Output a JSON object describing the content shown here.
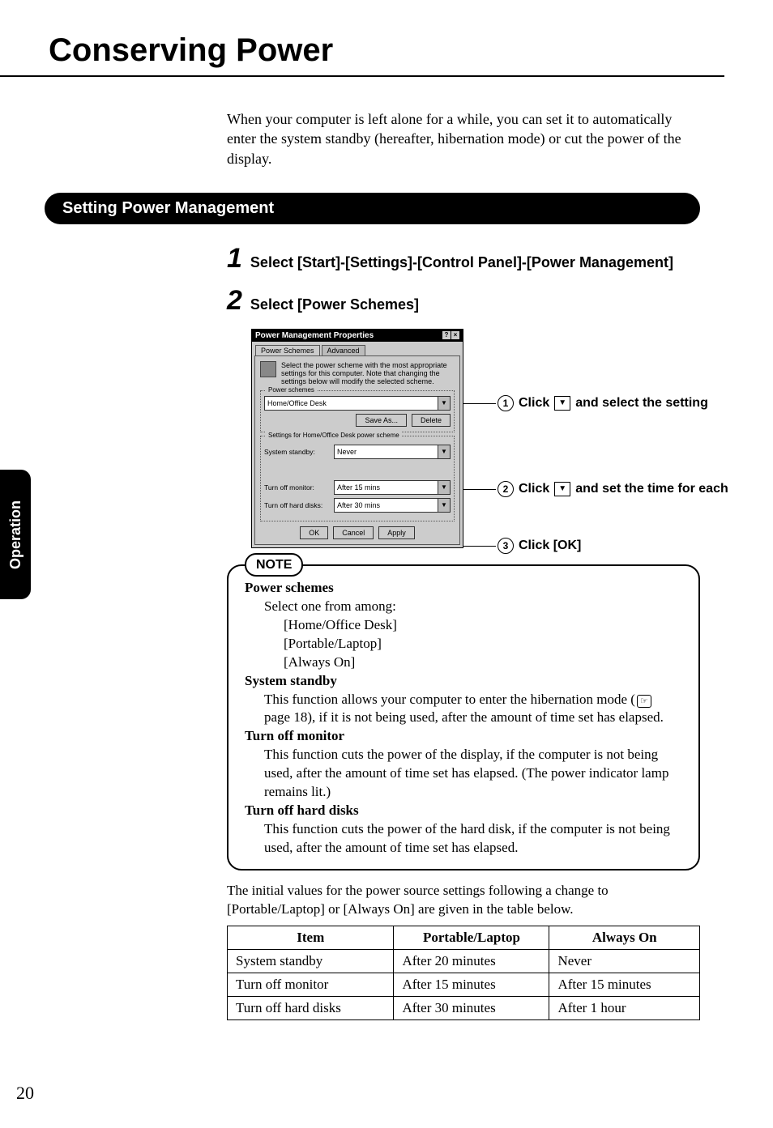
{
  "title": "Conserving Power",
  "intro": "When your computer is left alone for a while, you can set it to automatically enter the system standby (hereafter, hibernation mode) or cut the power of the display.",
  "side_tab": "Operation",
  "section_heading": "Setting Power Management",
  "steps": {
    "s1_num": "1",
    "s1_text": "Select [Start]-[Settings]-[Control Panel]-[Power Management]",
    "s2_num": "2",
    "s2_text": "Select [Power Schemes]"
  },
  "dialog": {
    "title": "Power Management Properties",
    "tab_active": "Power Schemes",
    "tab_inactive": "Advanced",
    "desc": "Select the power scheme with the most appropriate settings for this computer. Note that changing the settings below will modify the selected scheme.",
    "legend1": "Power schemes",
    "scheme_value": "Home/Office Desk",
    "btn_save": "Save As...",
    "btn_delete": "Delete",
    "legend2": "Settings for Home/Office Desk power scheme",
    "row_standby_label": "System standby:",
    "row_standby_value": "Never",
    "row_monitor_label": "Turn off monitor:",
    "row_monitor_value": "After 15 mins",
    "row_hd_label": "Turn off hard disks:",
    "row_hd_value": "After 30 mins",
    "btn_ok": "OK",
    "btn_cancel": "Cancel",
    "btn_apply": "Apply"
  },
  "callouts": {
    "c1_num": "1",
    "c1_pre": "Click",
    "c1_post": "and select the setting",
    "c2_num": "2",
    "c2_pre": "Click",
    "c2_post": "and set the time for each",
    "c3_num": "3",
    "c3_text": "Click [OK]"
  },
  "note": {
    "label": "NOTE",
    "h1": "Power schemes",
    "h1_sub": "Select one from among:",
    "h1_opt1": "[Home/Office Desk]",
    "h1_opt2": "[Portable/Laptop]",
    "h1_opt3": "[Always On]",
    "h2": "System standby",
    "h2_body_a": "This function allows your computer to enter the hibernation mode (",
    "h2_body_b": " page 18), if it is not being used, after the amount of time set has elapsed.",
    "h3": "Turn off monitor",
    "h3_body": "This function cuts the power of the display, if the computer is not being used, after the amount of time set has elapsed. (The power indicator lamp remains lit.)",
    "h4": "Turn off hard disks",
    "h4_body": "This function cuts the power of the hard disk, if the computer is not being used, after the amount of time set has elapsed."
  },
  "para_after_note": "The initial values for the power source settings following a change to [Portable/Laptop] or [Always On] are given in the table below.",
  "table": {
    "head_item": "Item",
    "head_portable": "Portable/Laptop",
    "head_always": "Always On",
    "rows": [
      {
        "item": "System standby",
        "portable": "After 20 minutes",
        "always": "Never"
      },
      {
        "item": "Turn off monitor",
        "portable": "After 15 minutes",
        "always": "After 15 minutes"
      },
      {
        "item": "Turn off hard disks",
        "portable": "After 30 minutes",
        "always": "After 1 hour"
      }
    ]
  },
  "page_number": "20"
}
